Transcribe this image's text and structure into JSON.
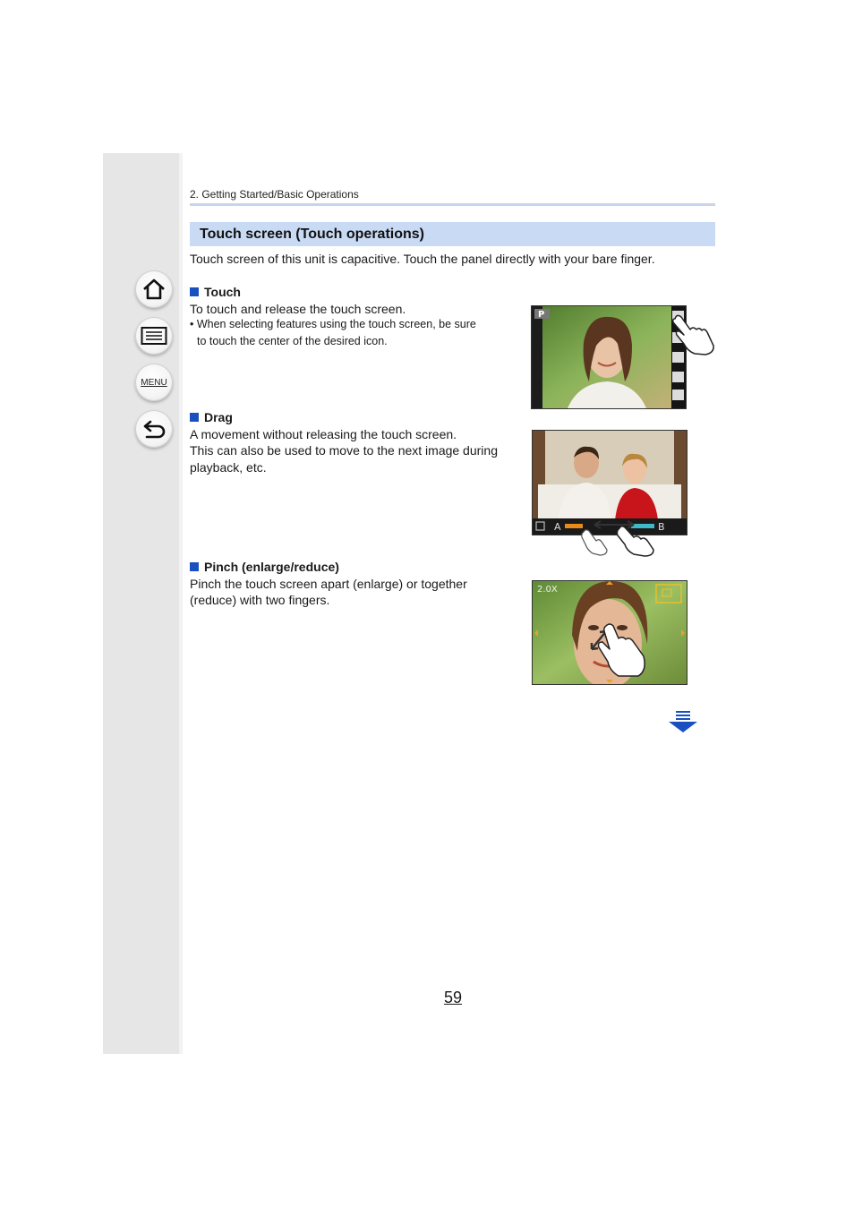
{
  "breadcrumb": "2. Getting Started/Basic Operations",
  "title": "Touch screen (Touch operations)",
  "intro": "Touch screen of this unit is capacitive. Touch the panel directly with your bare finger.",
  "sidebar": {
    "menu_label": "MENU"
  },
  "sections": {
    "touch": {
      "heading": "Touch",
      "text": "To touch and release the touch screen.",
      "note_line1": "• When selecting features using the touch screen, be sure",
      "note_line2": "to touch the center of the desired icon.",
      "screen_mode": "P"
    },
    "drag": {
      "heading": "Drag",
      "line1": "A movement without releasing the touch screen.",
      "line2": "This can also be used to move to the next image during",
      "line3": "playback, etc.",
      "label_a": "A",
      "label_b": "B"
    },
    "pinch": {
      "heading": "Pinch (enlarge/reduce)",
      "line1": "Pinch the touch screen apart (enlarge) or together",
      "line2": "(reduce) with two fingers.",
      "zoom_label": "2.0X"
    }
  },
  "page_number": "59",
  "colors": {
    "accent": "#1a4fc0",
    "title_bar": "#c9daf4",
    "sidebar": "#e6e6e6"
  }
}
